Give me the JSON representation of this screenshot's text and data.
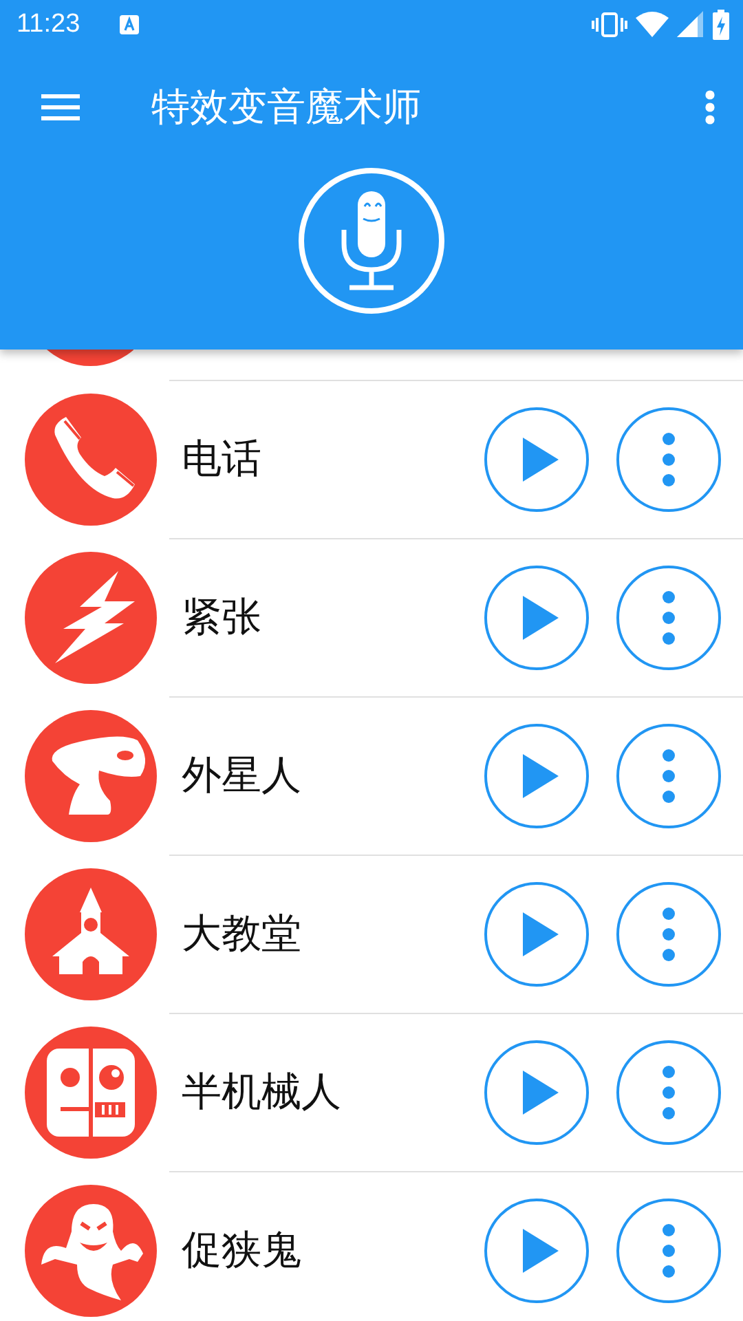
{
  "status_bar": {
    "time": "11:23"
  },
  "toolbar": {
    "title": "特效变音魔术师"
  },
  "effects": [
    {
      "kind": "cut"
    },
    {
      "kind": "phone",
      "label": "电话"
    },
    {
      "kind": "bolt",
      "label": "紧张"
    },
    {
      "kind": "alien",
      "label": "外星人"
    },
    {
      "kind": "church",
      "label": "大教堂"
    },
    {
      "kind": "robot",
      "label": "半机械人"
    },
    {
      "kind": "ghost",
      "label": "促狭鬼"
    }
  ]
}
